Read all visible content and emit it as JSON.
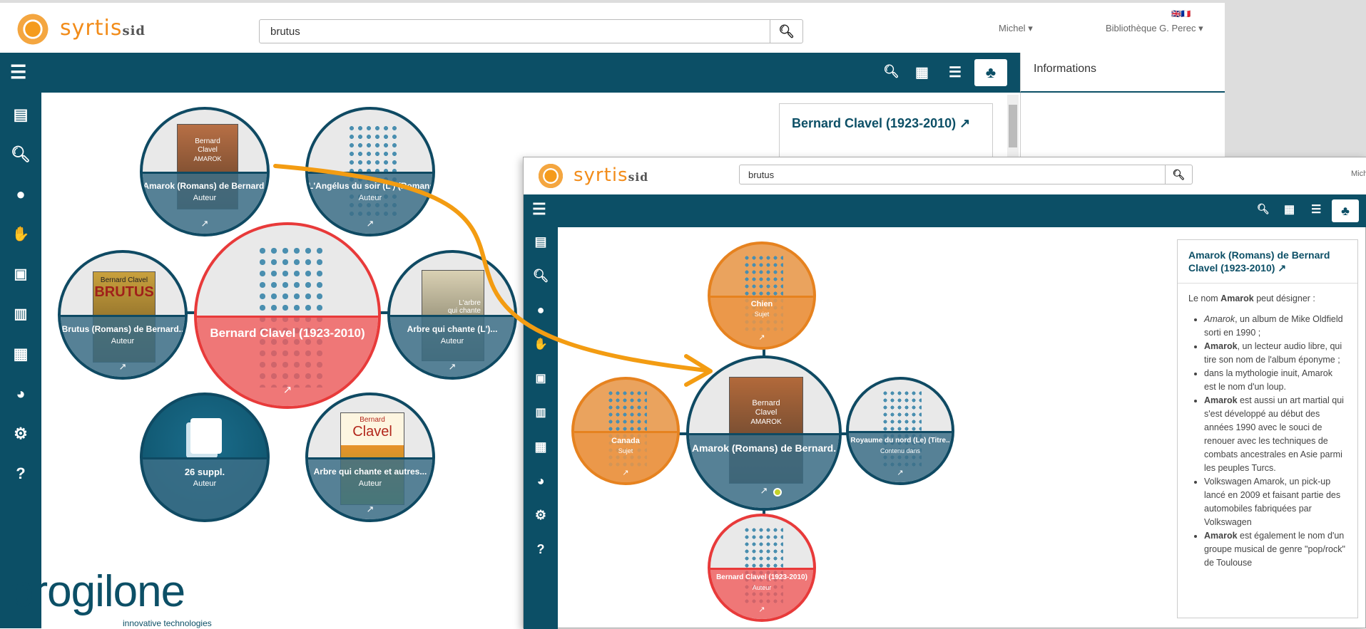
{
  "back": {
    "logo": {
      "text": "syrtis",
      "suffix": "sid"
    },
    "search": {
      "value": "brutus"
    },
    "user_menu": "Michel",
    "library_menu": "Bibliothèque G. Perec",
    "flags": "🇬🇧🇫🇷",
    "info_panel_title": "Informations",
    "card_title": "Bernard Clavel (1923-2010)",
    "bubbles": [
      {
        "title": "Bernard Clavel (1923-2010)",
        "subtitle": ""
      },
      {
        "title": "Amarok (Romans) de Bernard.",
        "subtitle": "Auteur"
      },
      {
        "title": "L'Angélus du soir (L') (Romans).",
        "subtitle": "Auteur"
      },
      {
        "title": "Brutus (Romans) de Bernard..",
        "subtitle": "Auteur"
      },
      {
        "title": "Arbre qui chante (L')...",
        "subtitle": "Auteur"
      },
      {
        "title": "26 suppl.",
        "subtitle": "Auteur"
      },
      {
        "title": "Arbre qui chante et autres...",
        "subtitle": "Auteur"
      }
    ],
    "covers": {
      "amarok": {
        "line1": "Bernard",
        "line2": "Clavel",
        "line3": "AMAROK"
      },
      "brutus": {
        "line1": "Bernard Clavel",
        "line2": "BRUTUS"
      },
      "arbre": {
        "line1": "L'arbre",
        "line2": "qui chante"
      },
      "arbre2": {
        "line1": "Bernard",
        "line2": "Clavel"
      }
    }
  },
  "front": {
    "logo": {
      "text": "syrtis",
      "suffix": "sid"
    },
    "search": {
      "value": "brutus"
    },
    "user_menu": "Mich",
    "card": {
      "title": "Amarok (Romans) de Bernard Clavel (1923-2010)",
      "intro_pre": "Le nom ",
      "intro_bold": "Amarok",
      "intro_post": " peut désigner :",
      "items": [
        {
          "b": "Amarok",
          "i": true,
          "t": ", un album de Mike Oldfield sorti en 1990 ;"
        },
        {
          "b": "Amarok",
          "i": false,
          "t": ", un lecteur audio libre, qui tire son nom de l'album éponyme ;"
        },
        {
          "b": "",
          "i": false,
          "t": "dans la mythologie inuit, Amarok est le nom d'un loup."
        },
        {
          "b": "Amarok",
          "i": false,
          "t": " est aussi un art martial qui s'est développé au début des années 1990 avec le souci de renouer avec les techniques de combats ancestrales en Asie parmi les peuples Turcs."
        },
        {
          "b": "",
          "i": false,
          "t": "Volkswagen Amarok, un pick-up lancé en 2009 et faisant partie des automobiles fabriquées par Volkswagen"
        },
        {
          "b": "Amarok",
          "i": false,
          "t": " est également le nom d'un groupe musical de genre \"pop/rock\" de Toulouse"
        }
      ]
    },
    "bubbles": [
      {
        "title": "Amarok (Romans) de Bernard.",
        "subtitle": ""
      },
      {
        "title": "Chien",
        "subtitle": "Sujet"
      },
      {
        "title": "Canada",
        "subtitle": "Sujet"
      },
      {
        "title": "Royaume du nord (Le) (Titre..",
        "subtitle": "Contenu dans"
      },
      {
        "title": "Bernard Clavel (1923-2010)",
        "subtitle": "Auteur"
      }
    ],
    "cover": {
      "line1": "Bernard",
      "line2": "Clavel",
      "line3": "AMAROK"
    }
  },
  "brand": {
    "name": "progilone",
    "tagline": "innovative technologies"
  },
  "colors": {
    "navbar": "#0c4f66",
    "accent_orange": "#f28c1a",
    "red": "#e83a3a",
    "teal": "#0f4a63"
  }
}
